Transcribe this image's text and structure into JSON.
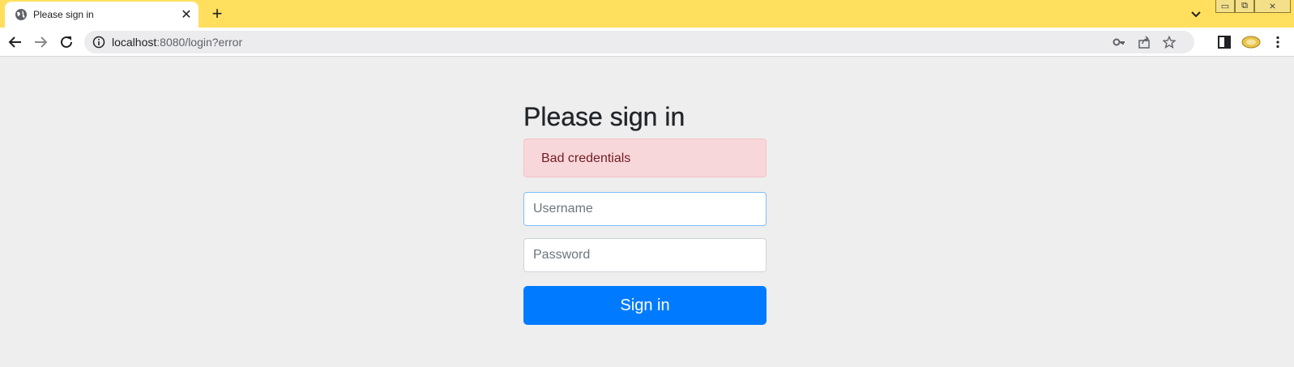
{
  "browser": {
    "tab": {
      "title": "Please sign in",
      "close_glyph": "✕",
      "icon": "globe-icon"
    },
    "new_tab_glyph": "+",
    "window_controls": {
      "minimize": "▭",
      "restore": "⧉",
      "close": "⨯"
    },
    "url": {
      "host": "localhost",
      "rest": ":8080/login?error"
    },
    "accent_color": "#ffdf5d"
  },
  "page": {
    "heading": "Please sign in",
    "alert": {
      "text": "Bad credentials",
      "color": "#f8d7da"
    },
    "username": {
      "value": "",
      "placeholder": "Username"
    },
    "password": {
      "value": "",
      "placeholder": "Password"
    },
    "submit_label": "Sign in",
    "submit_color": "#007bff"
  }
}
